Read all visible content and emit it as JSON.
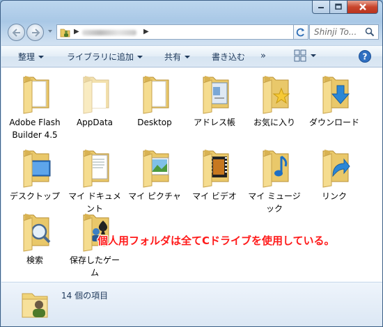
{
  "window": {
    "controls": [
      "minimize-icon",
      "maximize-icon",
      "close-icon"
    ]
  },
  "address_bar": {
    "search_placeholder": "Shinji To...",
    "icons": [
      "back-icon",
      "forward-icon",
      "refresh-icon",
      "search-icon"
    ]
  },
  "toolbar": {
    "organize": "整理",
    "add_to_library": "ライブラリに追加",
    "share": "共有",
    "burn": "書き込む",
    "more": "»"
  },
  "items": [
    {
      "label": "Adobe Flash Builder 4.5",
      "icon": "folder-icon"
    },
    {
      "label": "AppData",
      "icon": "folder-hidden-icon"
    },
    {
      "label": "Desktop",
      "icon": "folder-icon"
    },
    {
      "label": "アドレス帳",
      "icon": "contacts-folder-icon"
    },
    {
      "label": "お気に入り",
      "icon": "favorites-folder-icon"
    },
    {
      "label": "ダウンロード",
      "icon": "downloads-folder-icon"
    },
    {
      "label": "デスクトップ",
      "icon": "desktop-folder-icon"
    },
    {
      "label": "マイ ドキュメント",
      "icon": "documents-folder-icon"
    },
    {
      "label": "マイ ピクチャ",
      "icon": "pictures-folder-icon"
    },
    {
      "label": "マイ ビデオ",
      "icon": "videos-folder-icon"
    },
    {
      "label": "マイ ミュージック",
      "icon": "music-folder-icon"
    },
    {
      "label": "リンク",
      "icon": "links-folder-icon"
    },
    {
      "label": "検索",
      "icon": "searches-folder-icon"
    },
    {
      "label": "保存したゲーム",
      "icon": "saved-games-folder-icon"
    }
  ],
  "annotation": "個人用フォルダは全てCドライブを使用している。",
  "details": {
    "item_count": "14 個の項目"
  }
}
